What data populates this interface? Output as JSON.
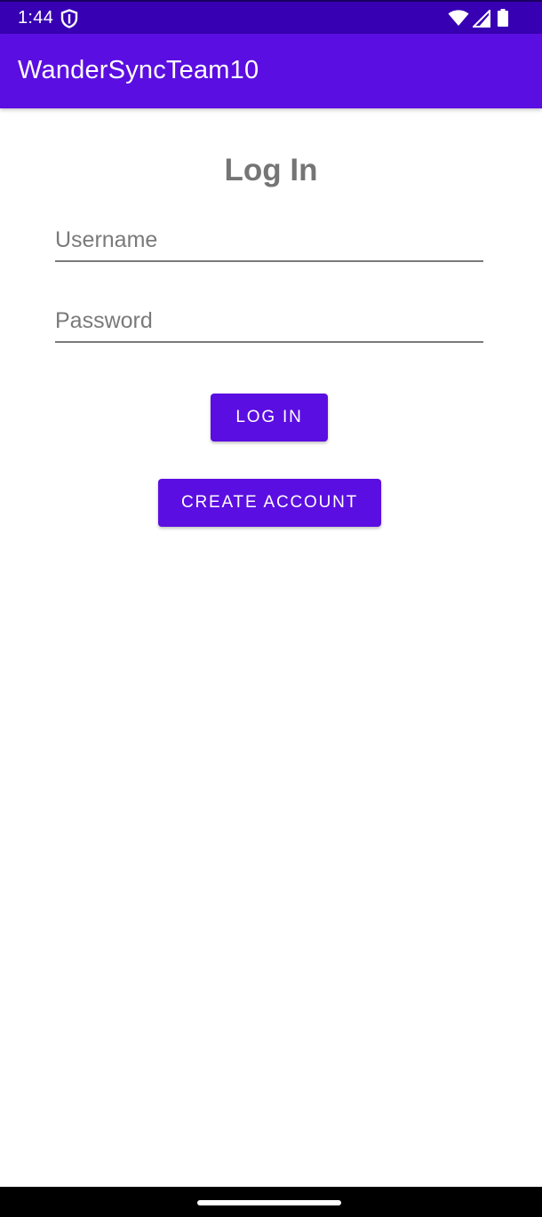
{
  "status_bar": {
    "time": "1:44",
    "icons": [
      "shield-icon",
      "wifi-icon",
      "signal-icon",
      "battery-icon"
    ]
  },
  "app_bar": {
    "title": "WanderSyncTeam10"
  },
  "login": {
    "heading": "Log In",
    "username_placeholder": "Username",
    "password_placeholder": "Password",
    "login_button_label": "Log In",
    "create_account_button_label": "Create Account"
  },
  "colors": {
    "status_bar": "#3700b3",
    "app_bar": "#5b0ee1",
    "primary_button": "#5b0ee1",
    "heading_text": "#757575"
  }
}
